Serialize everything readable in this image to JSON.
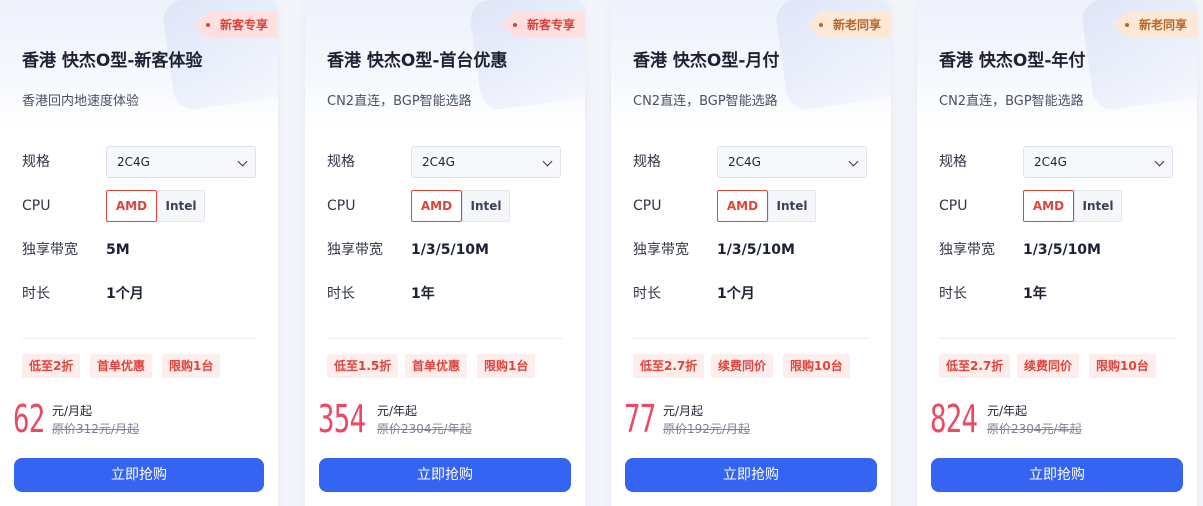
{
  "products": [
    {
      "tag": "新客专享",
      "tag_type": "new",
      "title": "香港 快杰O型-新客体验",
      "subtitle": "香港回内地速度体验",
      "spec_label": "规格",
      "spec_value": "2C4G",
      "cpu_label": "CPU",
      "cpu_options": [
        "AMD",
        "Intel"
      ],
      "cpu_selected": "AMD",
      "bandwidth_label": "独享带宽",
      "bandwidth_value": "5M",
      "duration_label": "时长",
      "duration_value": "1个月",
      "badges": [
        "低至2折",
        "首单优惠",
        "限购1台"
      ],
      "price": "62",
      "price_unit": "元/月起",
      "original_price": "原价312元/月起",
      "buy_label": "立即抢购"
    },
    {
      "tag": "新客专享",
      "tag_type": "new",
      "title": "香港 快杰O型-首台优惠",
      "subtitle": "CN2直连，BGP智能选路",
      "spec_label": "规格",
      "spec_value": "2C4G",
      "cpu_label": "CPU",
      "cpu_options": [
        "AMD",
        "Intel"
      ],
      "cpu_selected": "AMD",
      "bandwidth_label": "独享带宽",
      "bandwidth_value": "1/3/5/10M",
      "duration_label": "时长",
      "duration_value": "1年",
      "badges": [
        "低至1.5折",
        "首单优惠",
        "限购1台"
      ],
      "price": "354",
      "price_unit": "元/年起",
      "original_price": "原价2304元/年起",
      "buy_label": "立即抢购"
    },
    {
      "tag": "新老同享",
      "tag_type": "all",
      "title": "香港 快杰O型-月付",
      "subtitle": "CN2直连，BGP智能选路",
      "spec_label": "规格",
      "spec_value": "2C4G",
      "cpu_label": "CPU",
      "cpu_options": [
        "AMD",
        "Intel"
      ],
      "cpu_selected": "AMD",
      "bandwidth_label": "独享带宽",
      "bandwidth_value": "1/3/5/10M",
      "duration_label": "时长",
      "duration_value": "1个月",
      "badges": [
        "低至2.7折",
        "续费同价",
        "限购10台"
      ],
      "price": "77",
      "price_unit": "元/月起",
      "original_price": "原价192元/月起",
      "buy_label": "立即抢购"
    },
    {
      "tag": "新老同享",
      "tag_type": "all",
      "title": "香港 快杰O型-年付",
      "subtitle": "CN2直连，BGP智能选路",
      "spec_label": "规格",
      "spec_value": "2C4G",
      "cpu_label": "CPU",
      "cpu_options": [
        "AMD",
        "Intel"
      ],
      "cpu_selected": "AMD",
      "bandwidth_label": "独享带宽",
      "bandwidth_value": "1/3/5/10M",
      "duration_label": "时长",
      "duration_value": "1年",
      "badges": [
        "低至2.7折",
        "续费同价",
        "限购10台"
      ],
      "price": "824",
      "price_unit": "元/年起",
      "original_price": "原价2304元/年起",
      "buy_label": "立即抢购"
    }
  ],
  "colors": {
    "accent": "#3563f2",
    "price": "#ea4a64",
    "badge_text": "#e0443a",
    "badge_bg": "#fdeeed",
    "tag_new_bg": "#fde0df",
    "tag_all_bg": "#fde8d6"
  }
}
